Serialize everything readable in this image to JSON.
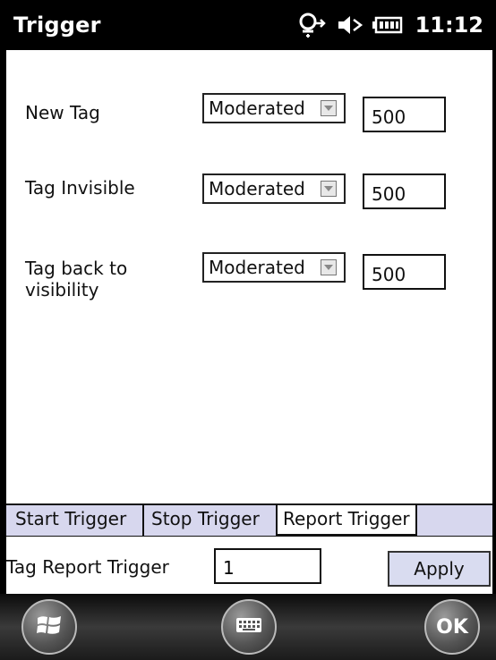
{
  "window": {
    "title": "Trigger",
    "time": "11:12",
    "status_icons": [
      "connectivity-icon",
      "volume-off-icon",
      "battery-icon"
    ]
  },
  "settings": [
    {
      "label_lines": [
        "New Tag"
      ],
      "mode": "Moderated",
      "value": "500"
    },
    {
      "label_lines": [
        "Tag Invisible"
      ],
      "mode": "Moderated",
      "value": "500"
    },
    {
      "label_lines": [
        "Tag back to",
        "visibility"
      ],
      "mode": "Moderated",
      "value": "500"
    }
  ],
  "tabs": [
    {
      "label": "Start Trigger",
      "selected": false
    },
    {
      "label": "Stop Trigger",
      "selected": false
    },
    {
      "label": "Report Trigger",
      "selected": true
    }
  ],
  "report": {
    "label": "Tag Report Trigger",
    "value": "1",
    "apply_label": "Apply"
  },
  "taskbar": {
    "start_icon": "windows-start-icon",
    "keyboard_icon": "keyboard-icon",
    "ok_label": "OK"
  },
  "colors": {
    "title_bar": "#000000",
    "tab_strip": "#d7d7ee",
    "apply_button": "#d9dcf0"
  }
}
